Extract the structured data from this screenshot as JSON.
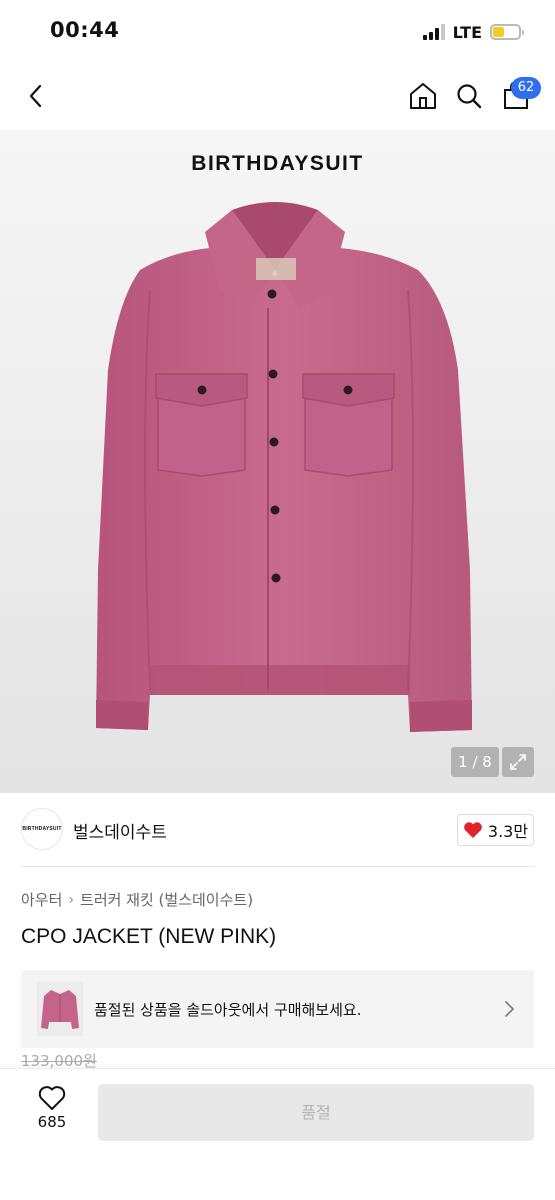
{
  "status_bar": {
    "time": "00:44",
    "network": "LTE",
    "battery_level": 0.4
  },
  "nav": {
    "back_icon": "chevron-left-icon",
    "home_icon": "home-icon",
    "search_icon": "search-icon",
    "cart_icon": "shopping-bag-icon",
    "cart_count": "62",
    "badge_color": "#2e6ff2"
  },
  "hero": {
    "brand_wordmark": "BIRTHDAYSUIT",
    "page_indicator": "1 / 8",
    "expand_icon": "expand-icon"
  },
  "brand": {
    "logo_text": "BIRTHDAYSUIT",
    "name": "벌스데이수트",
    "like_count": "3.3만",
    "like_icon": "heart-filled-icon",
    "like_color": "#e0242b"
  },
  "product": {
    "breadcrumb": [
      "아우터",
      "트러커 재킷 (벌스데이수트)"
    ],
    "title": "CPO JACKET (NEW PINK)",
    "original_price": "133,000원"
  },
  "soldout_banner": {
    "text": "품절된 상품을 솔드아웃에서 구매해보세요.",
    "chevron_icon": "chevron-right-icon"
  },
  "bottom_bar": {
    "wish_icon": "heart-outline-icon",
    "wish_count": "685",
    "buy_label": "품절"
  }
}
